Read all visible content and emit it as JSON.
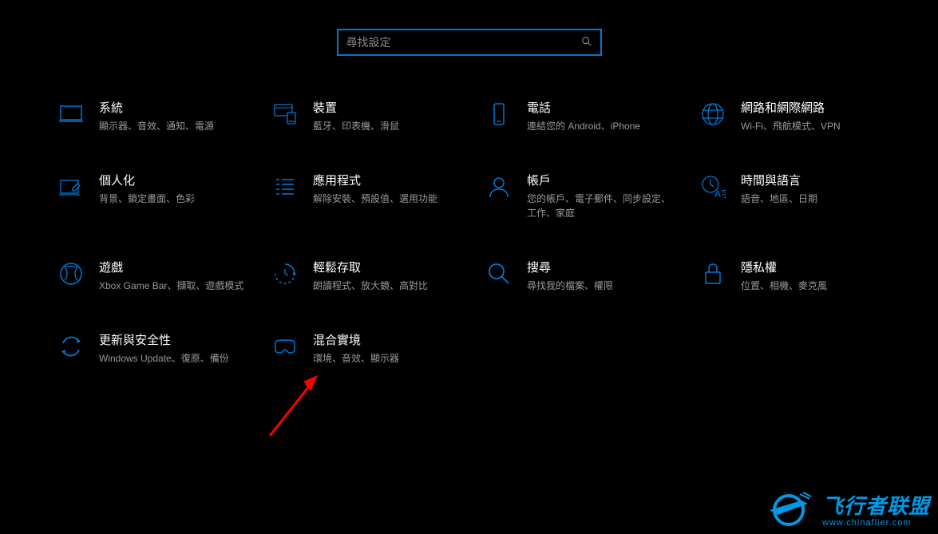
{
  "search": {
    "placeholder": "尋找設定"
  },
  "categories": [
    {
      "id": "system",
      "title": "系統",
      "desc": "顯示器、音效、通知、電源"
    },
    {
      "id": "devices",
      "title": "裝置",
      "desc": "藍牙、印表機、滑鼠"
    },
    {
      "id": "phone",
      "title": "電話",
      "desc": "連結您的 Android、iPhone"
    },
    {
      "id": "network",
      "title": "網路和網際網路",
      "desc": "Wi-Fi、飛航模式、VPN"
    },
    {
      "id": "personalization",
      "title": "個人化",
      "desc": "背景、鎖定畫面、色彩"
    },
    {
      "id": "apps",
      "title": "應用程式",
      "desc": "解除安裝、預設值、選用功能"
    },
    {
      "id": "accounts",
      "title": "帳戶",
      "desc": "您的帳戶、電子郵件、同步設定、工作、家庭"
    },
    {
      "id": "time-language",
      "title": "時間與語言",
      "desc": "語音、地區、日期"
    },
    {
      "id": "gaming",
      "title": "遊戲",
      "desc": "Xbox Game Bar、擷取、遊戲模式"
    },
    {
      "id": "ease-of-access",
      "title": "輕鬆存取",
      "desc": "朗讀程式、放大鏡、高對比"
    },
    {
      "id": "search",
      "title": "搜尋",
      "desc": "尋找我的檔案、權限"
    },
    {
      "id": "privacy",
      "title": "隱私權",
      "desc": "位置、相機、麥克風"
    },
    {
      "id": "update",
      "title": "更新與安全性",
      "desc": "Windows Update、復原、備份"
    },
    {
      "id": "mixed-reality",
      "title": "混合實境",
      "desc": "環境、音效、顯示器"
    }
  ],
  "watermark": {
    "main": "飞行者联盟",
    "sub": "www.chinaflier.com"
  },
  "colors": {
    "accent": "#0078d4",
    "iconBlue": "#0078d4",
    "watermarkBlue": "#0099e5"
  }
}
